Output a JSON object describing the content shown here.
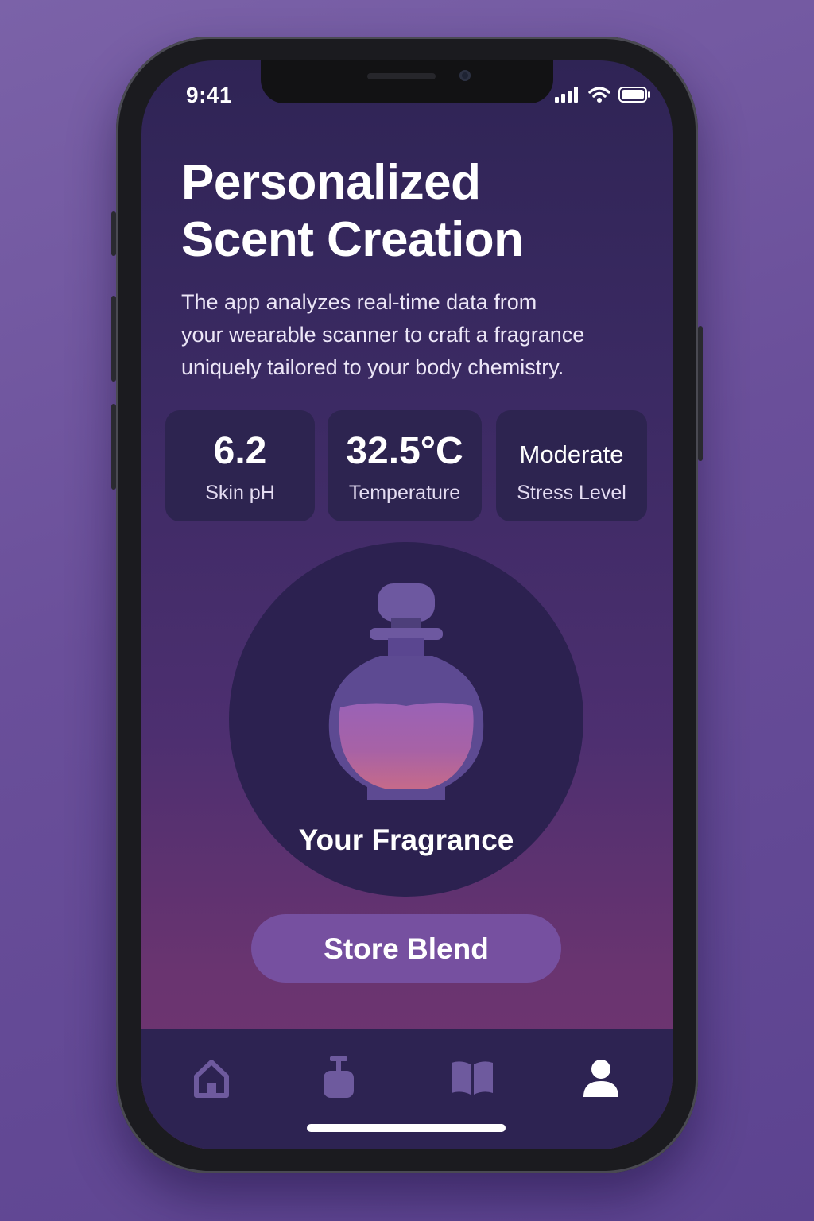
{
  "status_bar": {
    "time": "9:41"
  },
  "header": {
    "title_line1": "Personalized",
    "title_line2": "Scent Creation"
  },
  "description": {
    "line1": "The app analyzes real-time data from",
    "line2": "your wearable scanner to craft a fragrance",
    "line3": "uniquely tailored to your body chemistry."
  },
  "metrics": [
    {
      "value": "6.2",
      "label": "Skin pH"
    },
    {
      "value": "32.5°C",
      "label": "Temperature"
    },
    {
      "value": "Moderate",
      "label": "Stress Level"
    }
  ],
  "fragrance": {
    "label": "Your Fragrance"
  },
  "actions": {
    "store_label": "Store Blend"
  },
  "tab_bar": {
    "items": [
      {
        "icon": "home-icon",
        "active": false
      },
      {
        "icon": "perfume-bottle-icon",
        "active": false
      },
      {
        "icon": "book-icon",
        "active": false
      },
      {
        "icon": "profile-icon",
        "active": true
      }
    ]
  },
  "colors": {
    "accent": "#7650a0",
    "card": "#2d2450",
    "icon_inactive": "#6e5a9e",
    "icon_active": "#ffffff"
  }
}
